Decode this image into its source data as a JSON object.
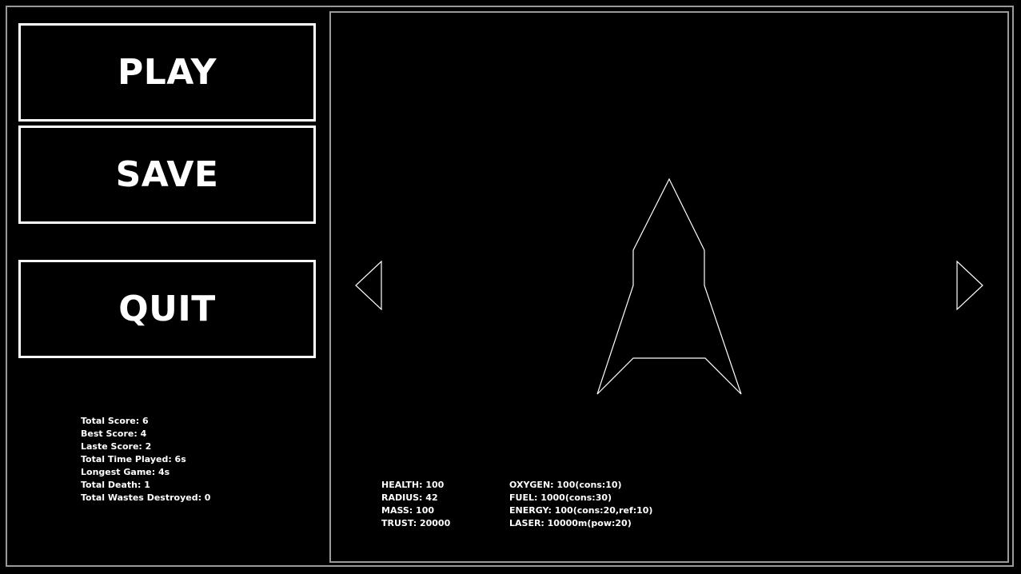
{
  "menu": {
    "play_label": "PLAY",
    "save_label": "SAVE",
    "quit_label": "QUIT"
  },
  "player_stats": {
    "total_score": "Total Score: 6",
    "best_score": "Best Score: 4",
    "last_score": "Laste Score: 2",
    "total_time": "Total Time Played: 6s",
    "longest_game": "Longest Game: 4s",
    "total_death": "Total Death: 1",
    "total_wastes": "Total Wastes Destroyed: 0"
  },
  "ship_stats": {
    "health": "HEALTH: 100",
    "radius": "RADIUS: 42",
    "mass": "MASS: 100",
    "trust": "TRUST: 20000",
    "oxygen": "OXYGEN: 100(cons:10)",
    "fuel": "FUEL: 1000(cons:30)",
    "energy": "ENERGY: 100(cons:20,ref:10)",
    "laser": "LASER: 10000m(pow:20)"
  },
  "icons": {
    "prev": "triangle-left-icon",
    "next": "triangle-right-icon",
    "ship": "spaceship-icon"
  },
  "colors": {
    "background": "#000000",
    "foreground": "#ffffff",
    "frame": "#9a9a9a"
  }
}
